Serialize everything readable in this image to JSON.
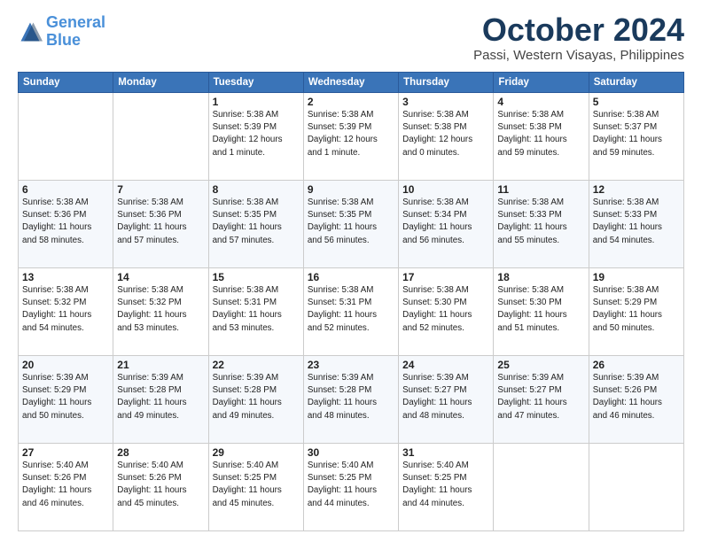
{
  "header": {
    "logo_line1": "General",
    "logo_line2": "Blue",
    "month": "October 2024",
    "location": "Passi, Western Visayas, Philippines"
  },
  "weekdays": [
    "Sunday",
    "Monday",
    "Tuesday",
    "Wednesday",
    "Thursday",
    "Friday",
    "Saturday"
  ],
  "weeks": [
    [
      {
        "day": "",
        "info": ""
      },
      {
        "day": "",
        "info": ""
      },
      {
        "day": "1",
        "info": "Sunrise: 5:38 AM\nSunset: 5:39 PM\nDaylight: 12 hours\nand 1 minute."
      },
      {
        "day": "2",
        "info": "Sunrise: 5:38 AM\nSunset: 5:39 PM\nDaylight: 12 hours\nand 1 minute."
      },
      {
        "day": "3",
        "info": "Sunrise: 5:38 AM\nSunset: 5:38 PM\nDaylight: 12 hours\nand 0 minutes."
      },
      {
        "day": "4",
        "info": "Sunrise: 5:38 AM\nSunset: 5:38 PM\nDaylight: 11 hours\nand 59 minutes."
      },
      {
        "day": "5",
        "info": "Sunrise: 5:38 AM\nSunset: 5:37 PM\nDaylight: 11 hours\nand 59 minutes."
      }
    ],
    [
      {
        "day": "6",
        "info": "Sunrise: 5:38 AM\nSunset: 5:36 PM\nDaylight: 11 hours\nand 58 minutes."
      },
      {
        "day": "7",
        "info": "Sunrise: 5:38 AM\nSunset: 5:36 PM\nDaylight: 11 hours\nand 57 minutes."
      },
      {
        "day": "8",
        "info": "Sunrise: 5:38 AM\nSunset: 5:35 PM\nDaylight: 11 hours\nand 57 minutes."
      },
      {
        "day": "9",
        "info": "Sunrise: 5:38 AM\nSunset: 5:35 PM\nDaylight: 11 hours\nand 56 minutes."
      },
      {
        "day": "10",
        "info": "Sunrise: 5:38 AM\nSunset: 5:34 PM\nDaylight: 11 hours\nand 56 minutes."
      },
      {
        "day": "11",
        "info": "Sunrise: 5:38 AM\nSunset: 5:33 PM\nDaylight: 11 hours\nand 55 minutes."
      },
      {
        "day": "12",
        "info": "Sunrise: 5:38 AM\nSunset: 5:33 PM\nDaylight: 11 hours\nand 54 minutes."
      }
    ],
    [
      {
        "day": "13",
        "info": "Sunrise: 5:38 AM\nSunset: 5:32 PM\nDaylight: 11 hours\nand 54 minutes."
      },
      {
        "day": "14",
        "info": "Sunrise: 5:38 AM\nSunset: 5:32 PM\nDaylight: 11 hours\nand 53 minutes."
      },
      {
        "day": "15",
        "info": "Sunrise: 5:38 AM\nSunset: 5:31 PM\nDaylight: 11 hours\nand 53 minutes."
      },
      {
        "day": "16",
        "info": "Sunrise: 5:38 AM\nSunset: 5:31 PM\nDaylight: 11 hours\nand 52 minutes."
      },
      {
        "day": "17",
        "info": "Sunrise: 5:38 AM\nSunset: 5:30 PM\nDaylight: 11 hours\nand 52 minutes."
      },
      {
        "day": "18",
        "info": "Sunrise: 5:38 AM\nSunset: 5:30 PM\nDaylight: 11 hours\nand 51 minutes."
      },
      {
        "day": "19",
        "info": "Sunrise: 5:38 AM\nSunset: 5:29 PM\nDaylight: 11 hours\nand 50 minutes."
      }
    ],
    [
      {
        "day": "20",
        "info": "Sunrise: 5:39 AM\nSunset: 5:29 PM\nDaylight: 11 hours\nand 50 minutes."
      },
      {
        "day": "21",
        "info": "Sunrise: 5:39 AM\nSunset: 5:28 PM\nDaylight: 11 hours\nand 49 minutes."
      },
      {
        "day": "22",
        "info": "Sunrise: 5:39 AM\nSunset: 5:28 PM\nDaylight: 11 hours\nand 49 minutes."
      },
      {
        "day": "23",
        "info": "Sunrise: 5:39 AM\nSunset: 5:28 PM\nDaylight: 11 hours\nand 48 minutes."
      },
      {
        "day": "24",
        "info": "Sunrise: 5:39 AM\nSunset: 5:27 PM\nDaylight: 11 hours\nand 48 minutes."
      },
      {
        "day": "25",
        "info": "Sunrise: 5:39 AM\nSunset: 5:27 PM\nDaylight: 11 hours\nand 47 minutes."
      },
      {
        "day": "26",
        "info": "Sunrise: 5:39 AM\nSunset: 5:26 PM\nDaylight: 11 hours\nand 46 minutes."
      }
    ],
    [
      {
        "day": "27",
        "info": "Sunrise: 5:40 AM\nSunset: 5:26 PM\nDaylight: 11 hours\nand 46 minutes."
      },
      {
        "day": "28",
        "info": "Sunrise: 5:40 AM\nSunset: 5:26 PM\nDaylight: 11 hours\nand 45 minutes."
      },
      {
        "day": "29",
        "info": "Sunrise: 5:40 AM\nSunset: 5:25 PM\nDaylight: 11 hours\nand 45 minutes."
      },
      {
        "day": "30",
        "info": "Sunrise: 5:40 AM\nSunset: 5:25 PM\nDaylight: 11 hours\nand 44 minutes."
      },
      {
        "day": "31",
        "info": "Sunrise: 5:40 AM\nSunset: 5:25 PM\nDaylight: 11 hours\nand 44 minutes."
      },
      {
        "day": "",
        "info": ""
      },
      {
        "day": "",
        "info": ""
      }
    ]
  ]
}
